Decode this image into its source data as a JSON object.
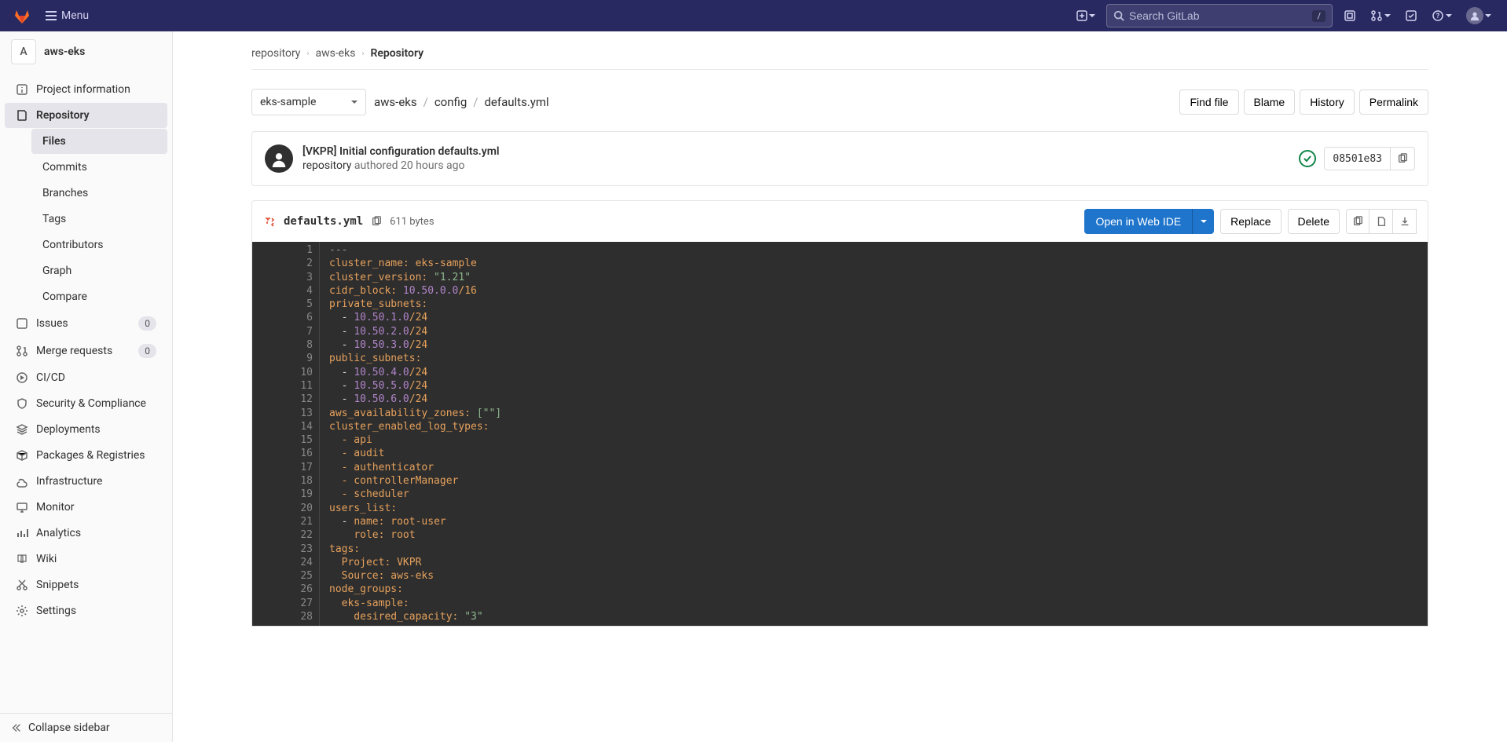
{
  "navbar": {
    "menu_label": "Menu",
    "search_placeholder": "Search GitLab",
    "search_hint": "/"
  },
  "project": {
    "avatar_letter": "A",
    "name": "aws-eks"
  },
  "sidebar": {
    "items": [
      {
        "label": "Project information"
      },
      {
        "label": "Repository"
      },
      {
        "label": "Issues"
      },
      {
        "label": "Merge requests"
      },
      {
        "label": "CI/CD"
      },
      {
        "label": "Security & Compliance"
      },
      {
        "label": "Deployments"
      },
      {
        "label": "Packages & Registries"
      },
      {
        "label": "Infrastructure"
      },
      {
        "label": "Monitor"
      },
      {
        "label": "Analytics"
      },
      {
        "label": "Wiki"
      },
      {
        "label": "Snippets"
      },
      {
        "label": "Settings"
      }
    ],
    "repo_sub": [
      "Files",
      "Commits",
      "Branches",
      "Tags",
      "Contributors",
      "Graph",
      "Compare"
    ],
    "issues_badge": "0",
    "mr_badge": "0",
    "collapse_label": "Collapse sidebar"
  },
  "breadcrumbs": [
    "repository",
    "aws-eks",
    "Repository"
  ],
  "branch_selected": "eks-sample",
  "path": [
    "aws-eks",
    "config",
    "defaults.yml"
  ],
  "actions": {
    "find": "Find file",
    "blame": "Blame",
    "history": "History",
    "permalink": "Permalink"
  },
  "commit": {
    "title": "[VKPR] Initial configuration defaults.yml",
    "author": "repository",
    "verb": "authored",
    "time": "20 hours ago",
    "sha": "08501e83"
  },
  "file": {
    "name": "defaults.yml",
    "size": "611 bytes",
    "open_ide": "Open in Web IDE",
    "replace": "Replace",
    "delete": "Delete"
  },
  "code_lines": 28,
  "code": {
    "l1": "---",
    "l2a": "cluster_name:",
    "l2b": " eks-sample",
    "l3a": "cluster_version:",
    "l3b": " \"1.21\"",
    "l4a": "cidr_block:",
    "l4b": " 10.50.0.0",
    "l4c": "/16",
    "l5": "private_subnets:",
    "l6a": "  - ",
    "l6b": "10.50.1.0",
    "l6c": "/24",
    "l7a": "  - ",
    "l7b": "10.50.2.0",
    "l7c": "/24",
    "l8a": "  - ",
    "l8b": "10.50.3.0",
    "l8c": "/24",
    "l9": "public_subnets:",
    "l10a": "  - ",
    "l10b": "10.50.4.0",
    "l10c": "/24",
    "l11a": "  - ",
    "l11b": "10.50.5.0",
    "l11c": "/24",
    "l12a": "  - ",
    "l12b": "10.50.6.0",
    "l12c": "/24",
    "l13a": "aws_availability_zones:",
    "l13b": " [\"\"]",
    "l14": "cluster_enabled_log_types:",
    "l15": "  - api",
    "l16": "  - audit",
    "l17": "  - authenticator",
    "l18": "  - controllerManager",
    "l19": "  - scheduler",
    "l20": "users_list:",
    "l21a": "  - ",
    "l21b": "name:",
    "l21c": " root-user",
    "l22a": "    ",
    "l22b": "role:",
    "l22c": " root",
    "l23": "tags:",
    "l24a": "  Project:",
    "l24b": " VKPR",
    "l25a": "  Source:",
    "l25b": " aws-eks",
    "l26": "node_groups:",
    "l27": "  eks-sample:",
    "l28a": "    desired_capacity:",
    "l28b": " \"3\""
  }
}
